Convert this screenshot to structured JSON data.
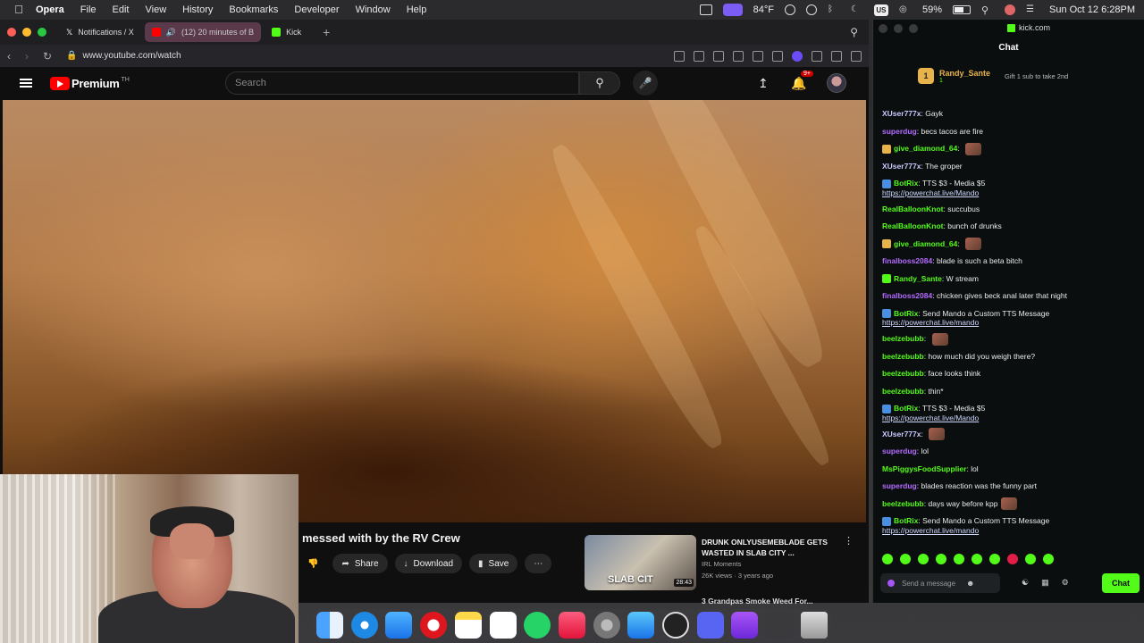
{
  "menubar": {
    "app": "Opera",
    "items": [
      "File",
      "Edit",
      "View",
      "History",
      "Bookmarks",
      "Developer",
      "Window",
      "Help"
    ],
    "weather": "84°F",
    "battery": "59%",
    "battery_level": 0.59,
    "keyboard": "US",
    "datetime": "Sun Oct 12  6:28PM"
  },
  "browser": {
    "tabs": [
      {
        "label": "Notifications / X",
        "icon_color": "#000000"
      },
      {
        "label": "(12) 20 minutes of B",
        "icon_color": "#ff0000"
      },
      {
        "label": "Kick",
        "icon_color": "#53fc18"
      }
    ],
    "url": "www.youtube.com/watch",
    "accent": "#6b4cf5"
  },
  "youtube": {
    "logo": "Premium",
    "logo_sup": "TH",
    "search_placeholder": "Search",
    "notif_count": "9+",
    "video_title": "messed with by the RV Crew",
    "actions": {
      "share": "Share",
      "download": "Download",
      "save": "Save",
      "more": "⋯"
    },
    "related": {
      "title": "DRUNK ONLYUSEMEBLADE GETS WASTED IN SLAB CITY ...",
      "channel": "IRL Moments",
      "meta": "26K views · 3 years ago",
      "thumb_caption": "SLAB CIT",
      "duration": "28:43"
    },
    "related2_title": "3 Grandpas Smoke Weed For..."
  },
  "chat": {
    "site": "kick.com",
    "title": "Chat",
    "pinned": {
      "rank": "1",
      "name": "Randy_Sante",
      "count": "1",
      "gift": "Gift 1 sub to take 2nd"
    },
    "messages": [
      {
        "user": "XUser777x",
        "color": "#c9c9ff",
        "text": "Gayk"
      },
      {
        "user": "superdug",
        "color": "#b36bff",
        "text": "becs tacos are fire"
      },
      {
        "user": "give_diamond_64",
        "color": "#53fc18",
        "text": "",
        "emote": true,
        "badge": "#e8b34a"
      },
      {
        "user": "XUser777x",
        "color": "#c9c9ff",
        "text": "The groper"
      },
      {
        "user": "BotRix",
        "color": "#53fc18",
        "text": "TTS $3 - Media $5",
        "badge": "#4a90e2",
        "link": "https://powerchat.live/Mando"
      },
      {
        "user": "RealBalloonKnot",
        "color": "#53fc18",
        "text": "succubus"
      },
      {
        "user": "RealBalloonKnot",
        "color": "#53fc18",
        "text": "bunch of drunks"
      },
      {
        "user": "give_diamond_64",
        "color": "#53fc18",
        "text": "",
        "emote": true,
        "badge": "#e8b34a"
      },
      {
        "user": "finalboss2084",
        "color": "#b36bff",
        "text": "blade is such a beta bitch"
      },
      {
        "user": "Randy_Sante",
        "color": "#53fc18",
        "text": "W stream",
        "badge": "#53fc18"
      },
      {
        "user": "finalboss2084",
        "color": "#b36bff",
        "text": "chicken gives beck anal later that night"
      },
      {
        "user": "BotRix",
        "color": "#53fc18",
        "text": "Send Mando a Custom TTS Message",
        "badge": "#4a90e2",
        "link": "https://powerchat.live/mando"
      },
      {
        "user": "beelzebubb",
        "color": "#53fc18",
        "text": "",
        "emote": true
      },
      {
        "user": "beelzebubb",
        "color": "#53fc18",
        "text": "how much did you weigh there?"
      },
      {
        "user": "beelzebubb",
        "color": "#53fc18",
        "text": "face looks think"
      },
      {
        "user": "beelzebubb",
        "color": "#53fc18",
        "text": "thin*"
      },
      {
        "user": "BotRix",
        "color": "#53fc18",
        "text": "TTS $3 - Media $5",
        "badge": "#4a90e2",
        "link": "https://powerchat.live/Mando"
      },
      {
        "user": "XUser777x",
        "color": "#c9c9ff",
        "text": "",
        "emote": true
      },
      {
        "user": "superdug",
        "color": "#b36bff",
        "text": "lol"
      },
      {
        "user": "MsPiggysFoodSupplier",
        "color": "#53fc18",
        "text": "lol"
      },
      {
        "user": "superdug",
        "color": "#b36bff",
        "text": "blades reaction was the funny part"
      },
      {
        "user": "beelzebubb",
        "color": "#53fc18",
        "text": "days way before kpp",
        "emote": true
      },
      {
        "user": "BotRix",
        "color": "#53fc18",
        "text": "Send Mando a Custom TTS Message",
        "badge": "#4a90e2",
        "link": "https://powerchat.live/mando"
      }
    ],
    "input_placeholder": "Send a message",
    "send_label": "Chat"
  }
}
